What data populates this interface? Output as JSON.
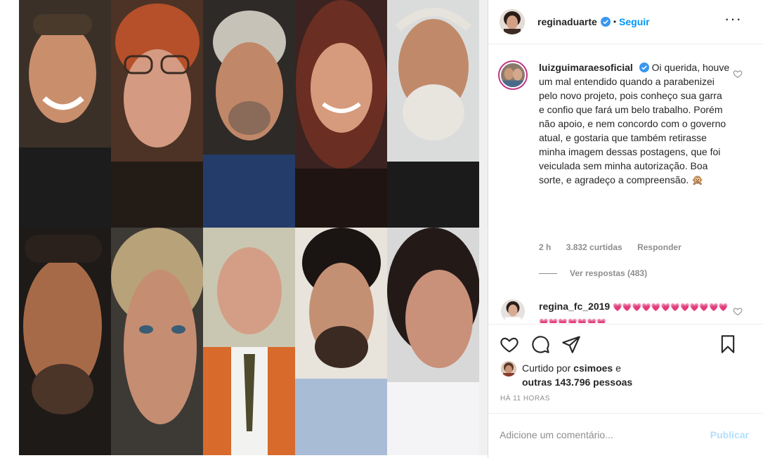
{
  "post": {
    "author": "reginaduarte",
    "follow_label": "Seguir",
    "dot": "•",
    "more_label": "···"
  },
  "comments": [
    {
      "user": "luizguimaraesoficial",
      "text": "Oi querida, houve um mal entendido quando a parabenizei pelo novo projeto, pois conheço sua garra e confio que fará um belo trabalho. Porém não apoio, e nem concordo com o governo atual, e gostaria que também retirasse minha imagem dessas postagens, que foi veiculada sem minha autorização. Boa sorte, e agradeço a compreensão. 🙊",
      "time": "2 h",
      "likes": "3.832 curtidas",
      "reply_label": "Responder",
      "view_replies": "Ver respostas (483)"
    },
    {
      "user": "regina_fc_2019",
      "text": "💗💗💗💗💗💗💗💗💗💗💗💗💗💗💗💗💗💗💗"
    }
  ],
  "likes": {
    "prefix": "Curtido por",
    "user": "csimoes",
    "connector": "e",
    "others": "outras 143.796 pessoas"
  },
  "timestamp": "HÁ 11 HORAS",
  "comment_box": {
    "placeholder": "Adicione um comentário...",
    "publish_label": "Publicar"
  },
  "colors": {
    "link_blue": "#0095f6",
    "publish_disabled": "#b2dffc",
    "meta_gray": "#8e8e8e",
    "text": "#262626"
  },
  "icons": [
    "verified-icon",
    "more-icon",
    "heart-icon",
    "comment-icon",
    "share-icon",
    "bookmark-icon"
  ]
}
